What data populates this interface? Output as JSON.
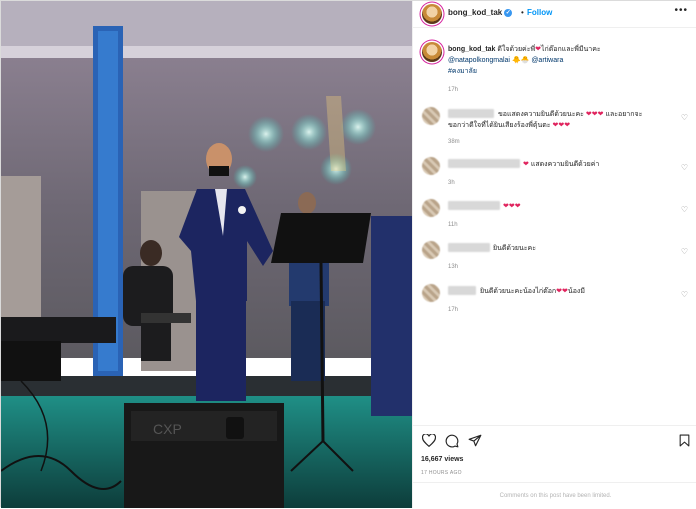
{
  "header": {
    "username": "bong_kod_tak",
    "verified_mark": "✓",
    "separator": "•",
    "follow_label": "Follow",
    "more_icon": "more-horizontal-icon",
    "more_glyph": "•••"
  },
  "caption": {
    "username": "bong_kod_tak",
    "text_1": "ดีใจด้วยค่ะพี่",
    "text_2": "ไก่ต๊อกและพี่มีนาคะ",
    "mention_1": "@natapolkongmalai",
    "emoji": "🐥🐣",
    "mention_2": "@artiwara",
    "hashtag": "#คงมาลัย",
    "time": "17h"
  },
  "comments": [
    {
      "text": "ขอแสดงความยินดีด้วยนะคะ ❤️❤️❤️ และอยากจะขอกว่าดีใจที่ได้ยินเสียงร้องพี่ตุ้นตะ ❤️❤️❤️",
      "line1": "ขอแสดงความยินดีด้วยนะคะ",
      "line2": "และอยากจะ",
      "line3": "ขอกว่าดีใจที่ได้ยินเสียงร้องพี่ตุ้นตะ",
      "time": "38m"
    },
    {
      "text": "แสดงความยินดีด้วยค่า",
      "time": "3h"
    },
    {
      "text": "",
      "time": "11h"
    },
    {
      "text": "ยินดีด้วยนะคะ",
      "time": "13h"
    },
    {
      "text": "ยินดีด้วยนะคะน้องไก่ต๊อก",
      "text_end": "น้องมี",
      "time": "17h"
    }
  ],
  "heart_glyph": "❤",
  "like_glyph": "♡",
  "actions": {
    "like_icon": "heart-icon",
    "comment_icon": "comment-icon",
    "share_icon": "share-icon",
    "save_icon": "bookmark-icon"
  },
  "views": "16,667 views",
  "posted_ago": "17 HOURS AGO",
  "comments_limited": "Comments on this post have been limited.",
  "photo": {
    "speaker_brand": "CXP"
  }
}
